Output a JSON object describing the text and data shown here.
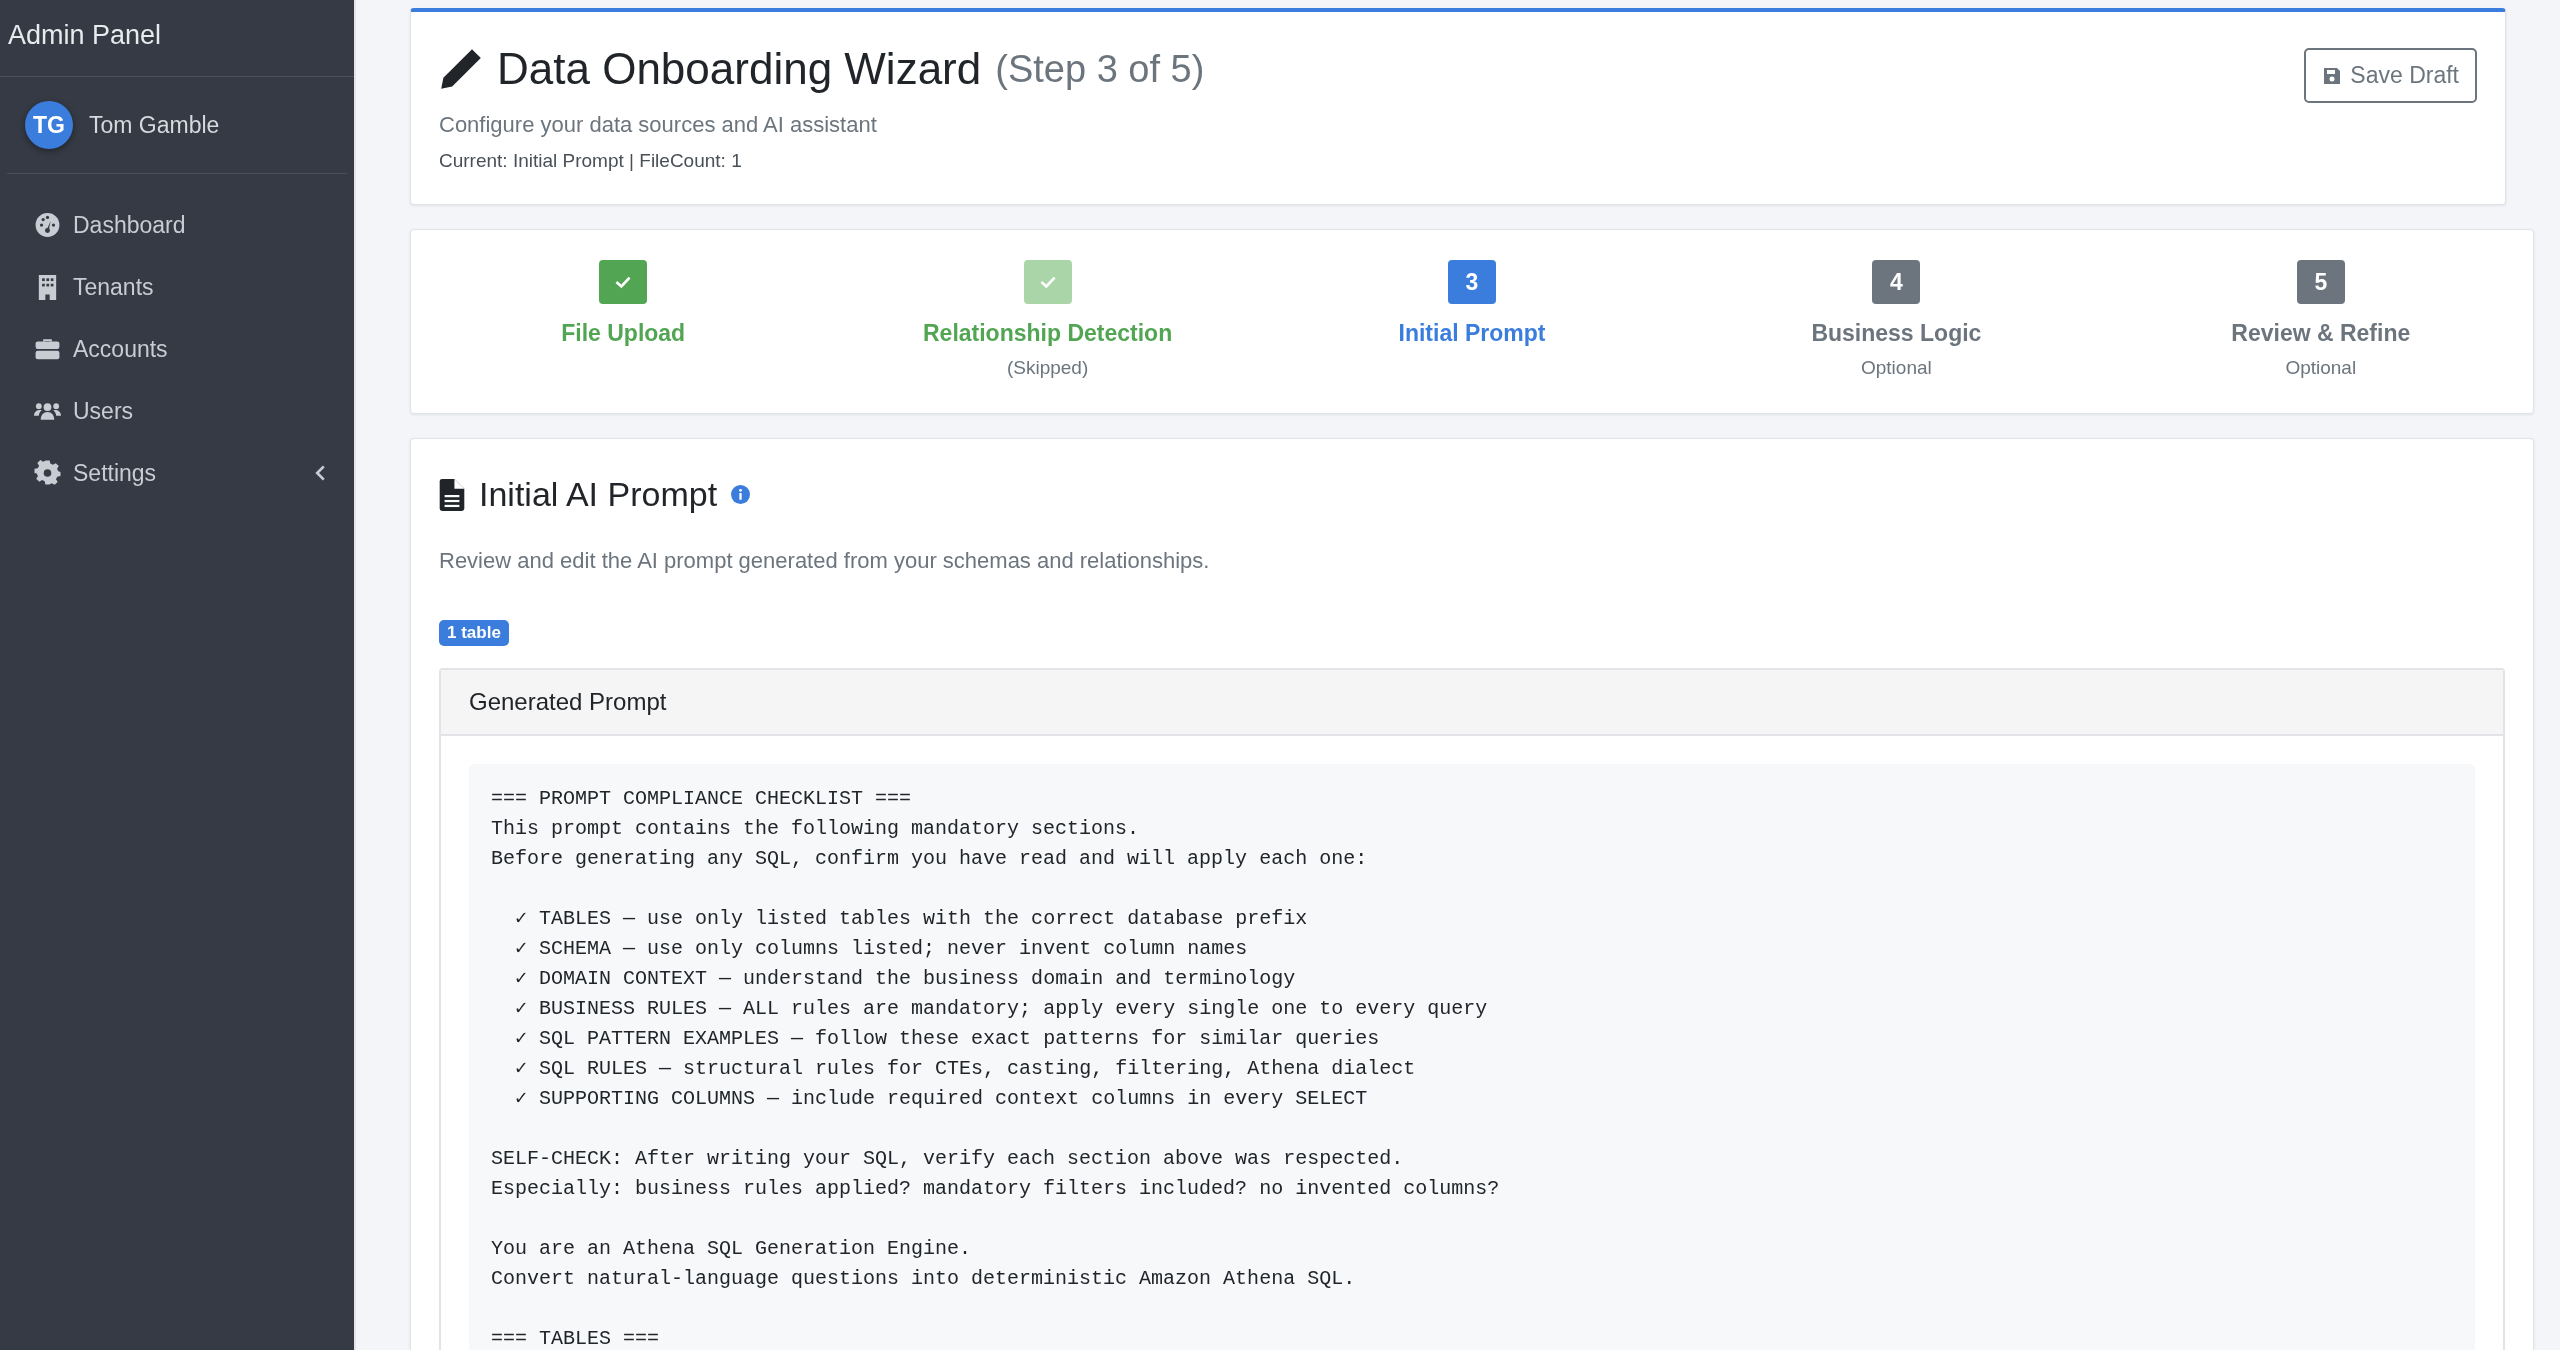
{
  "sidebar": {
    "brand": "Admin Panel",
    "user": {
      "initials": "TG",
      "name": "Tom Gamble"
    },
    "items": [
      {
        "label": "Dashboard",
        "has_submenu": false
      },
      {
        "label": "Tenants",
        "has_submenu": false
      },
      {
        "label": "Accounts",
        "has_submenu": false
      },
      {
        "label": "Users",
        "has_submenu": false
      },
      {
        "label": "Settings",
        "has_submenu": true
      }
    ]
  },
  "header": {
    "title": "Data Onboarding Wizard",
    "step_note": "(Step 3 of 5)",
    "subtitle": "Configure your data sources and AI assistant",
    "status_line": "Current: Initial Prompt | FileCount: 1",
    "save_button": "Save Draft"
  },
  "steps": [
    {
      "label": "File Upload",
      "completed": true,
      "skipped": false,
      "selected": false
    },
    {
      "label": "Relationship Detection",
      "completed": false,
      "skipped": true,
      "selected": false,
      "note": "(Skipped)"
    },
    {
      "label": "Initial Prompt",
      "completed": false,
      "skipped": false,
      "selected": true,
      "number": "3"
    },
    {
      "label": "Business Logic",
      "completed": false,
      "skipped": false,
      "selected": false,
      "number": "4",
      "note": "Optional"
    },
    {
      "label": "Review & Refine",
      "completed": false,
      "skipped": false,
      "selected": false,
      "number": "5",
      "note": "Optional"
    }
  ],
  "prompt_section": {
    "title": "Initial AI Prompt",
    "description": "Review and edit the AI prompt generated from your schemas and relationships.",
    "badge": "1 table",
    "panel_title": "Generated Prompt",
    "blocks": [
      {
        "kind": "text",
        "lines": [
          "=== PROMPT COMPLIANCE CHECKLIST ===",
          "This prompt contains the following mandatory sections.",
          "Before generating any SQL, confirm you have read and will apply each one:"
        ]
      },
      {
        "kind": "checklist",
        "lines": [
          "✓ TABLES — use only listed tables with the correct database prefix",
          "✓ SCHEMA — use only columns listed; never invent column names",
          "✓ DOMAIN CONTEXT — understand the business domain and terminology",
          "✓ BUSINESS RULES — ALL rules are mandatory; apply every single one to every query",
          "✓ SQL PATTERN EXAMPLES — follow these exact patterns for similar queries",
          "✓ SQL RULES — structural rules for CTEs, casting, filtering, Athena dialect",
          "✓ SUPPORTING COLUMNS — include required context columns in every SELECT"
        ]
      },
      {
        "kind": "text",
        "lines": [
          "SELF-CHECK: After writing your SQL, verify each section above was respected.",
          "Especially: business rules applied? mandatory filters included? no invented columns?"
        ]
      },
      {
        "kind": "text",
        "lines": [
          "You are an Athena SQL Generation Engine.",
          "Convert natural-language questions into deterministic Amazon Athena SQL."
        ]
      },
      {
        "kind": "text",
        "lines": [
          "=== TABLES ==="
        ]
      }
    ]
  }
}
